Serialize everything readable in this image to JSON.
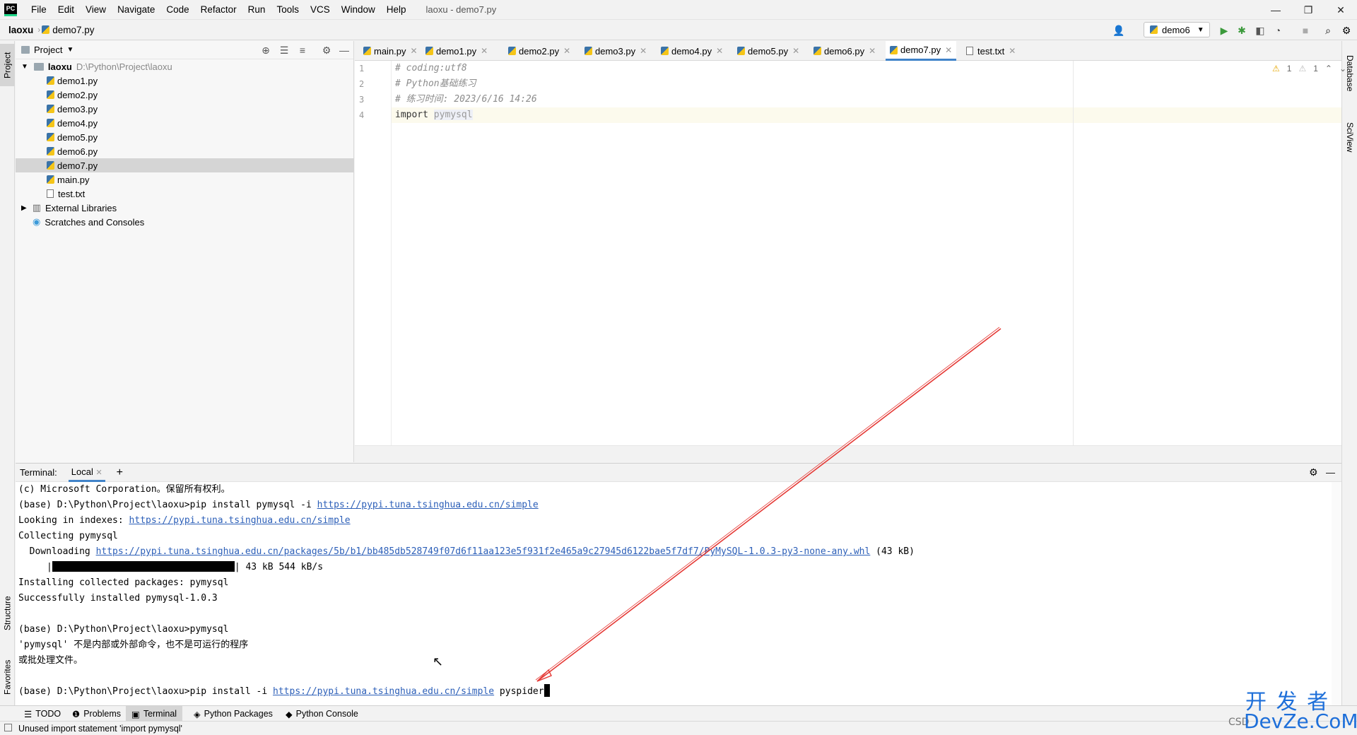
{
  "window": {
    "app_logo": "PC",
    "menu": [
      "File",
      "Edit",
      "View",
      "Navigate",
      "Code",
      "Refactor",
      "Run",
      "Tools",
      "VCS",
      "Window",
      "Help"
    ],
    "title": "laoxu - demo7.py",
    "controls": {
      "minimize": "—",
      "restore": "❐",
      "close": "✕"
    }
  },
  "navbar": {
    "project": "laoxu",
    "file": "demo7.py",
    "run_config": "demo6"
  },
  "left_stripe": {
    "project_tab": "Project",
    "structure_tab": "Structure",
    "favorites_tab": "Favorites"
  },
  "right_stripe": {
    "database_tab": "Database",
    "sciview_tab": "SciView"
  },
  "project_panel": {
    "title": "Project",
    "root_name": "laoxu",
    "root_path": "D:\\Python\\Project\\laoxu",
    "files": [
      "demo1.py",
      "demo2.py",
      "demo3.py",
      "demo4.py",
      "demo5.py",
      "demo6.py",
      "demo7.py",
      "main.py",
      "test.txt"
    ],
    "selected_file": "demo7.py",
    "external_libraries": "External Libraries",
    "scratches": "Scratches and Consoles"
  },
  "editor": {
    "tabs": [
      "main.py",
      "demo1.py",
      "demo2.py",
      "demo3.py",
      "demo4.py",
      "demo5.py",
      "demo6.py",
      "demo7.py",
      "test.txt"
    ],
    "active_tab": "demo7.py",
    "line_numbers": [
      "1",
      "2",
      "3",
      "4"
    ],
    "lines": {
      "l1": "# coding:utf8",
      "l2": "# Python基础练习",
      "l3": "# 练习时间: 2023/6/16 14:26",
      "l4_keyword": "import",
      "l4_module": "pymysql"
    },
    "inspection": {
      "warn1": "1",
      "warn2": "1"
    }
  },
  "terminal": {
    "label": "Terminal:",
    "tab": "Local",
    "add": "+",
    "lines": {
      "t1": "(c) Microsoft Corporation。保留所有权利。",
      "t2_prefix": "(base) D:\\Python\\Project\\laoxu>pip install pymysql -i ",
      "t2_link": "https://pypi.tuna.tsinghua.edu.cn/simple",
      "t3_prefix": "Looking in indexes: ",
      "t3_link": "https://pypi.tuna.tsinghua.edu.cn/simple",
      "t4": "Collecting pymysql",
      "t5_prefix": "  Downloading ",
      "t5_link": "https://pypi.tuna.tsinghua.edu.cn/packages/5b/b1/bb485db528749f07d6f11aa123e5f931f2e465a9c27945d6122bae5f7df7/PyMySQL-1.0.3-py3-none-any.whl",
      "t5_suffix": " (43 kB)",
      "t6_suffix": "| 43 kB 544 kB/s",
      "t7": "Installing collected packages: pymysql",
      "t8": "Successfully installed pymysql-1.0.3",
      "t9": "(base) D:\\Python\\Project\\laoxu>pymysql",
      "t10": "'pymysql' 不是内部或外部命令，也不是可运行的程序",
      "t11": "或批处理文件。",
      "t12_prefix": "(base) D:\\Python\\Project\\laoxu>pip install -i ",
      "t12_link": "https://pypi.tuna.tsinghua.edu.cn/simple",
      "t12_suffix": " pyspider"
    }
  },
  "bottom_tabs": [
    "TODO",
    "Problems",
    "Terminal",
    "Python Packages",
    "Python Console"
  ],
  "active_bottom_tab": "Terminal",
  "status_bar": {
    "message": "Unused import statement 'import pymysql'"
  },
  "watermark": {
    "line1": "开 发 者",
    "line2": "DevZe.CoM",
    "prefix": "CSD"
  },
  "colors": {
    "accent": "#4083c9",
    "link": "#2c5fb8",
    "annotation_arrow": "#e53935"
  }
}
